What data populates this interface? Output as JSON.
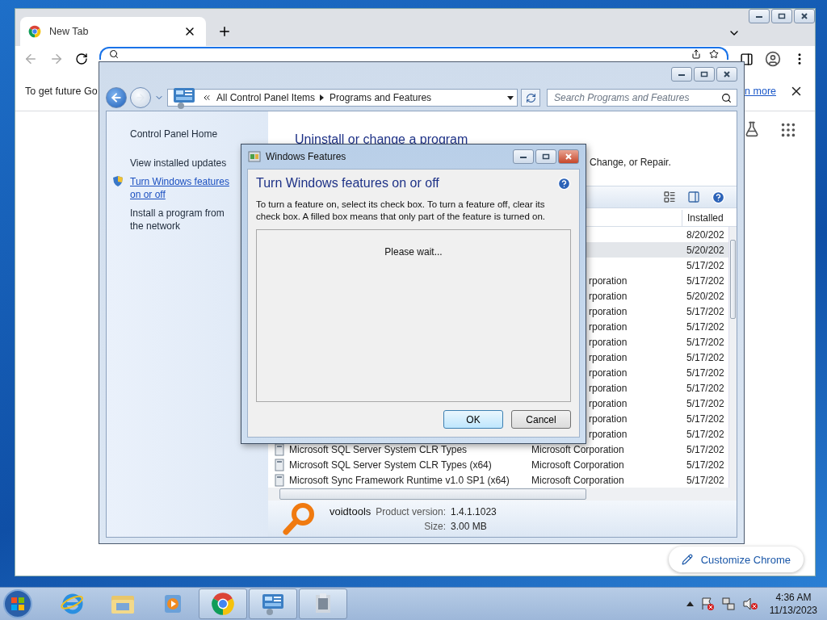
{
  "chrome": {
    "tab": {
      "title": "New Tab"
    },
    "infobar": {
      "text": "To get future Go",
      "link": "n more"
    },
    "customize_button": "Customize Chrome"
  },
  "control_panel": {
    "breadcrumb": [
      "All Control Panel Items",
      "Programs and Features"
    ],
    "search": {
      "placeholder": "Search Programs and Features"
    },
    "sidebar": {
      "items": [
        {
          "label": "Control Panel Home",
          "kind": "plain",
          "hovered": false
        },
        {
          "label": "View installed updates",
          "kind": "plain",
          "hovered": false
        },
        {
          "label": "Turn Windows features on or off",
          "kind": "shield",
          "hovered": true
        },
        {
          "label": "Install a program from the network",
          "kind": "plain",
          "hovered": false
        }
      ]
    },
    "title": "Uninstall or change a program",
    "subtitle": "Change, or Repair.",
    "table": {
      "columns": [
        "Installed"
      ],
      "rows": [
        {
          "kind": "date_only",
          "date": "8/20/202",
          "selected": false
        },
        {
          "kind": "date_only",
          "date": "5/20/202",
          "selected": true
        },
        {
          "kind": "date_only",
          "date": "5/17/202",
          "selected": false
        },
        {
          "kind": "clipped",
          "publisher": "rporation",
          "date": "5/17/202",
          "selected": false
        },
        {
          "kind": "clipped",
          "publisher": "rporation",
          "date": "5/20/202",
          "selected": false
        },
        {
          "kind": "clipped",
          "publisher": "rporation",
          "date": "5/17/202",
          "selected": false
        },
        {
          "kind": "clipped",
          "publisher": "rporation",
          "date": "5/17/202",
          "selected": false
        },
        {
          "kind": "clipped",
          "publisher": "rporation",
          "date": "5/17/202",
          "selected": false
        },
        {
          "kind": "clipped",
          "publisher": "rporation",
          "date": "5/17/202",
          "selected": false
        },
        {
          "kind": "clipped",
          "publisher": "rporation",
          "date": "5/17/202",
          "selected": false
        },
        {
          "kind": "clipped",
          "publisher": "rporation",
          "date": "5/17/202",
          "selected": false
        },
        {
          "kind": "clipped",
          "publisher": "rporation",
          "date": "5/17/202",
          "selected": false
        },
        {
          "kind": "clipped",
          "publisher": "rporation",
          "date": "5/17/202",
          "selected": false
        },
        {
          "kind": "clipped",
          "publisher": "rporation",
          "date": "5/17/202",
          "selected": false
        },
        {
          "kind": "full",
          "name": "Microsoft SQL Server System CLR Types",
          "publisher": "Microsoft Corporation",
          "date": "5/17/202",
          "selected": false
        },
        {
          "kind": "full",
          "name": "Microsoft SQL Server System CLR Types (x64)",
          "publisher": "Microsoft Corporation",
          "date": "5/17/202",
          "selected": false
        },
        {
          "kind": "full",
          "name": "Microsoft Sync Framework Runtime v1.0 SP1 (x64)",
          "publisher": "Microsoft Corporation",
          "date": "5/17/202",
          "selected": false
        }
      ]
    },
    "details": {
      "publisher": "voidtools",
      "version_label": "Product version:",
      "version": "1.4.1.1023",
      "size_label": "Size:",
      "size": "3.00 MB"
    }
  },
  "dialog": {
    "title": "Windows Features",
    "heading": "Turn Windows features on or off",
    "description": "To turn a feature on, select its check box. To turn a feature off, clear its check box. A filled box means that only part of the feature is turned on.",
    "status": "Please wait...",
    "buttons": [
      {
        "label": "OK",
        "default": true
      },
      {
        "label": "Cancel",
        "default": false
      }
    ]
  },
  "taskbar": {
    "apps": [
      {
        "kind": "ie",
        "active": false
      },
      {
        "kind": "explorer",
        "active": false
      },
      {
        "kind": "media",
        "active": false
      },
      {
        "kind": "chrome",
        "active": true
      },
      {
        "kind": "control_panel",
        "active": true
      },
      {
        "kind": "installer",
        "active": true
      }
    ],
    "time": "4:36 AM",
    "date": "11/13/2023"
  }
}
